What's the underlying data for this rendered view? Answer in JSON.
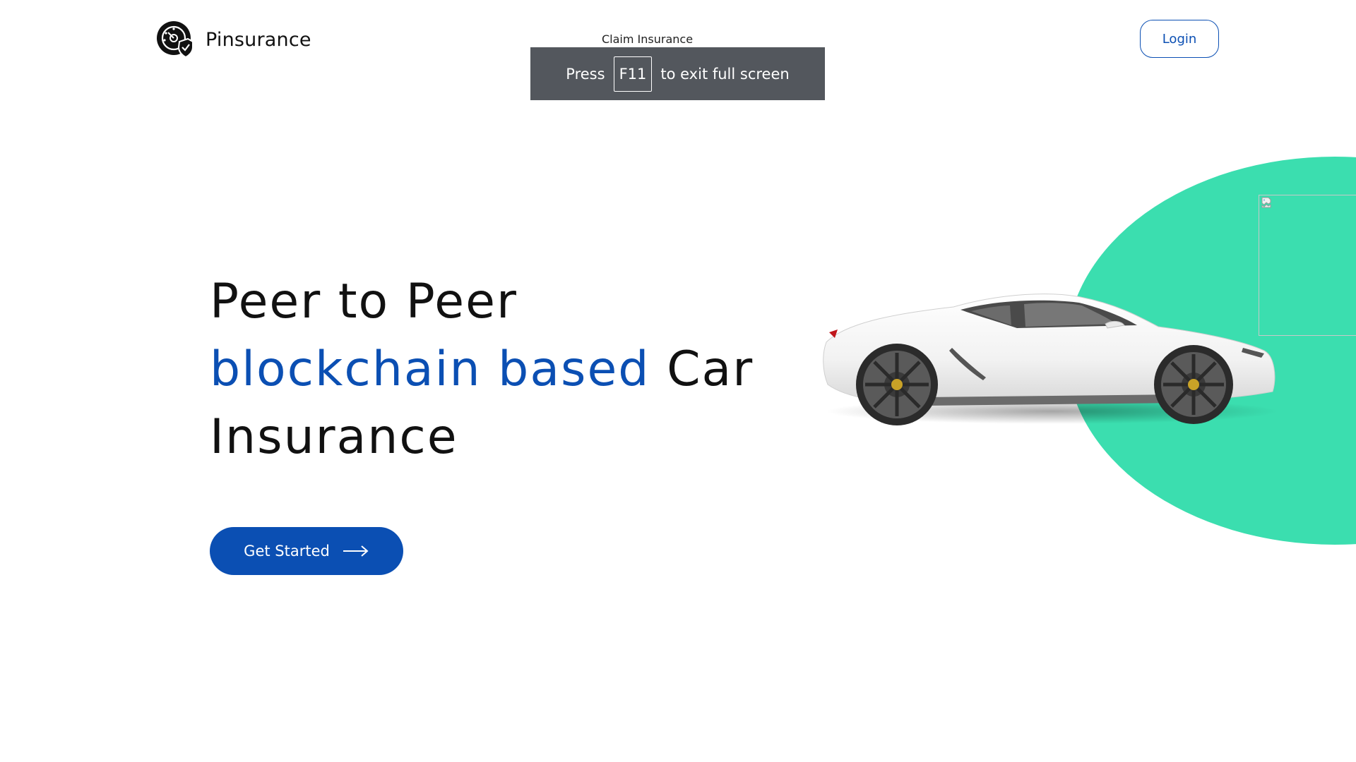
{
  "header": {
    "brand_name": "Pinsurance",
    "logo_icon": "shield-gauge-logo-icon",
    "nav_link": "Claim Insurance",
    "login_label": "Login"
  },
  "fullscreen_toast": {
    "press": "Press",
    "key": "F11",
    "suffix": "to exit full screen"
  },
  "hero": {
    "line1": "Peer to Peer",
    "line2_accent": "blockchain based",
    "line2_rest": " Car",
    "line3": "Insurance",
    "cta_label": "Get Started",
    "cta_icon": "arrow-right-icon"
  },
  "visual": {
    "blob_color": "#3bdeaf",
    "car_icon": "sports-car-image",
    "broken_image_icon": "broken-image-icon"
  },
  "colors": {
    "accent": "#0b4fb3",
    "toast_bg": "#53575d"
  }
}
